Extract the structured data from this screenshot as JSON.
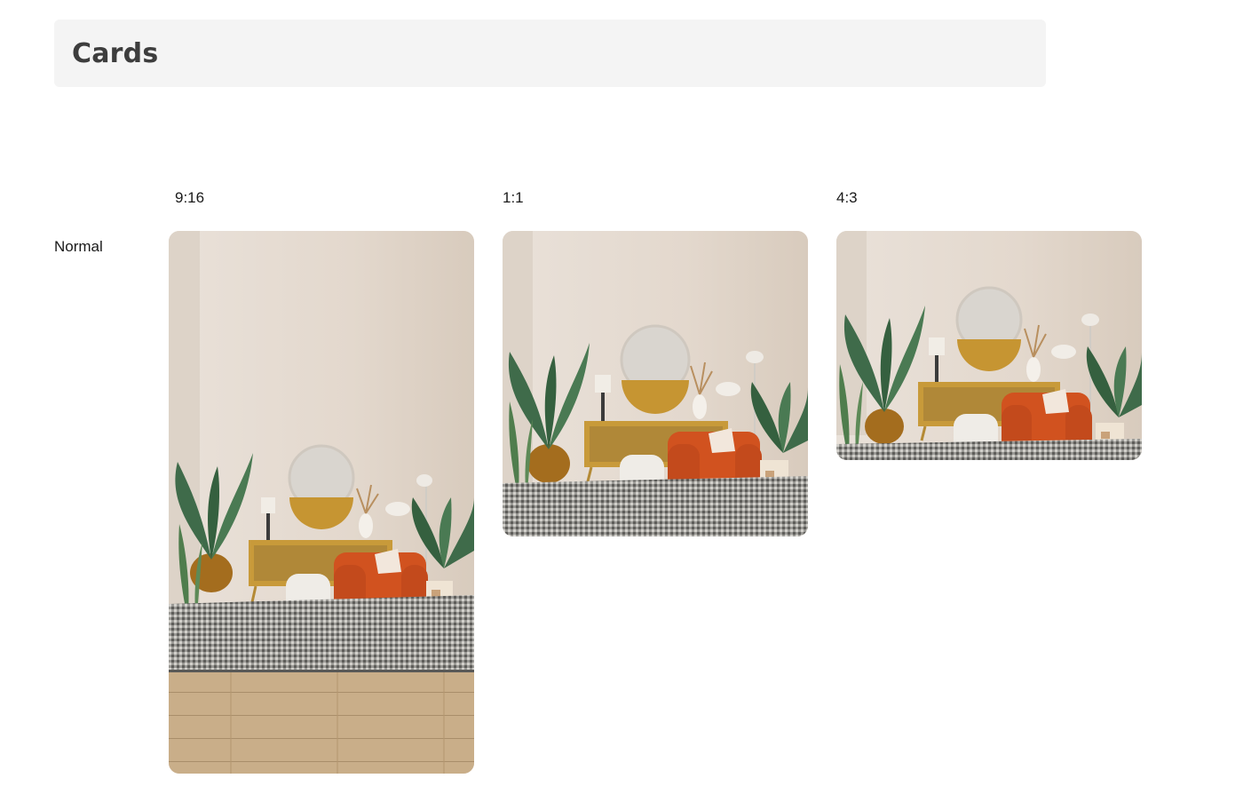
{
  "header": {
    "title": "Cards"
  },
  "columns": [
    {
      "label": "9:16"
    },
    {
      "label": "1:1"
    },
    {
      "label": "4:3"
    }
  ],
  "rows": [
    {
      "label": "Normal"
    }
  ],
  "cards": [
    {
      "aspect": "9:16",
      "image": "living-room-interior-photo"
    },
    {
      "aspect": "1:1",
      "image": "living-room-interior-photo"
    },
    {
      "aspect": "4:3",
      "image": "living-room-interior-photo"
    }
  ],
  "colors": {
    "header_bg": "#f4f4f4",
    "wall": "#e6ddd4",
    "armchair": "#d1521f",
    "sideboard": "#c89a3a",
    "plant": "#3f6b4a",
    "rug": "#8a8a86",
    "floor": "#c6ab86"
  }
}
